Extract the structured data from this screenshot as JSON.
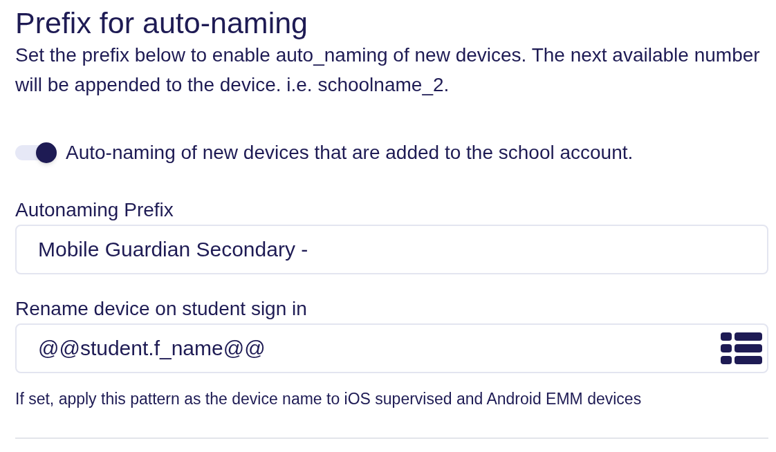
{
  "section": {
    "title": "Prefix for auto-naming",
    "description": "Set the prefix below to enable auto_naming of new devices. The next available number will be appended to the device. i.e. schoolname_2."
  },
  "auto_naming_toggle": {
    "label": "Auto-naming of new devices that are added to the school account.",
    "on": true
  },
  "fields": [
    {
      "kind": "text",
      "label": "Autonaming Prefix",
      "value": "Mobile Guardian Secondary -"
    },
    {
      "kind": "pattern",
      "label": "Rename device on student sign in",
      "value": "@@student.f_name@@",
      "help_text": "If set, apply this pattern as the device name to iOS supervised and Android EMM devices"
    }
  ]
}
